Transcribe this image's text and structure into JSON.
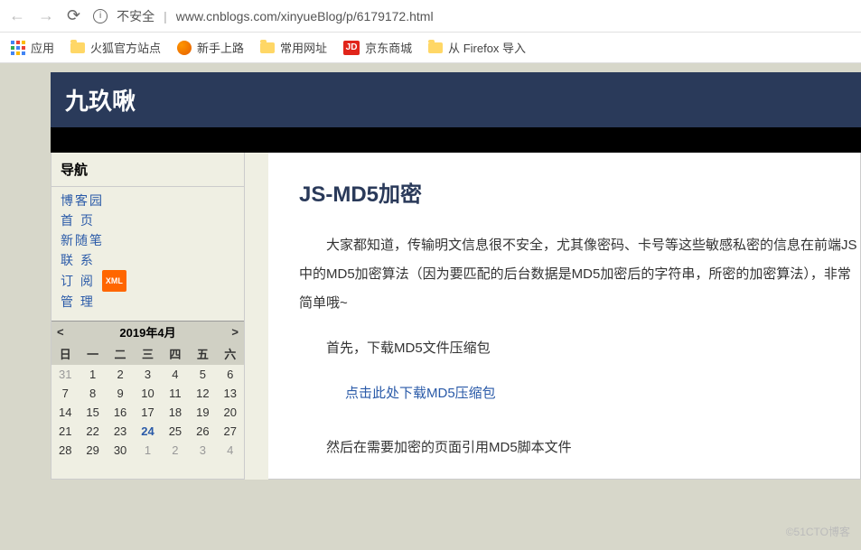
{
  "browser": {
    "unsafe_label": "不安全",
    "url": "www.cnblogs.com/xinyueBlog/p/6179172.html"
  },
  "bookmarks": {
    "apps": "应用",
    "firefox_site": "火狐官方站点",
    "newbie": "新手上路",
    "common": "常用网址",
    "jd_label": "JD",
    "jd": "京东商城",
    "ff_import": "从 Firefox 导入"
  },
  "blog": {
    "title": "九玖啾",
    "nav_title": "导航",
    "nav": {
      "home": "博客园",
      "front": "首  页",
      "new_post": "新随笔",
      "contact": "联  系",
      "subscribe": "订  阅",
      "xml": "XML",
      "admin": "管  理"
    }
  },
  "calendar": {
    "prev": "<",
    "title": "2019年4月",
    "next": ">",
    "dow": [
      "日",
      "一",
      "二",
      "三",
      "四",
      "五",
      "六"
    ],
    "days": [
      {
        "n": "31",
        "cls": "other"
      },
      {
        "n": "1"
      },
      {
        "n": "2"
      },
      {
        "n": "3"
      },
      {
        "n": "4"
      },
      {
        "n": "5"
      },
      {
        "n": "6"
      },
      {
        "n": "7"
      },
      {
        "n": "8"
      },
      {
        "n": "9"
      },
      {
        "n": "10"
      },
      {
        "n": "11"
      },
      {
        "n": "12"
      },
      {
        "n": "13"
      },
      {
        "n": "14"
      },
      {
        "n": "15"
      },
      {
        "n": "16"
      },
      {
        "n": "17"
      },
      {
        "n": "18"
      },
      {
        "n": "19"
      },
      {
        "n": "20"
      },
      {
        "n": "21"
      },
      {
        "n": "22"
      },
      {
        "n": "23"
      },
      {
        "n": "24",
        "cls": "today"
      },
      {
        "n": "25"
      },
      {
        "n": "26"
      },
      {
        "n": "27"
      },
      {
        "n": "28"
      },
      {
        "n": "29"
      },
      {
        "n": "30"
      },
      {
        "n": "1",
        "cls": "other"
      },
      {
        "n": "2",
        "cls": "other"
      },
      {
        "n": "3",
        "cls": "other"
      },
      {
        "n": "4",
        "cls": "other"
      }
    ]
  },
  "article": {
    "title": "JS-MD5加密",
    "p1": "大家都知道，传输明文信息很不安全，尤其像密码、卡号等这些敏感私密的信息在前端JS中的MD5加密算法（因为要匹配的后台数据是MD5加密后的字符串，所密的加密算法），非常简单哦~",
    "p2": "首先，下载MD5文件压缩包",
    "link": "点击此处下载MD5压缩包",
    "p3": "然后在需要加密的页面引用MD5脚本文件"
  },
  "watermark": "©51CTO博客"
}
